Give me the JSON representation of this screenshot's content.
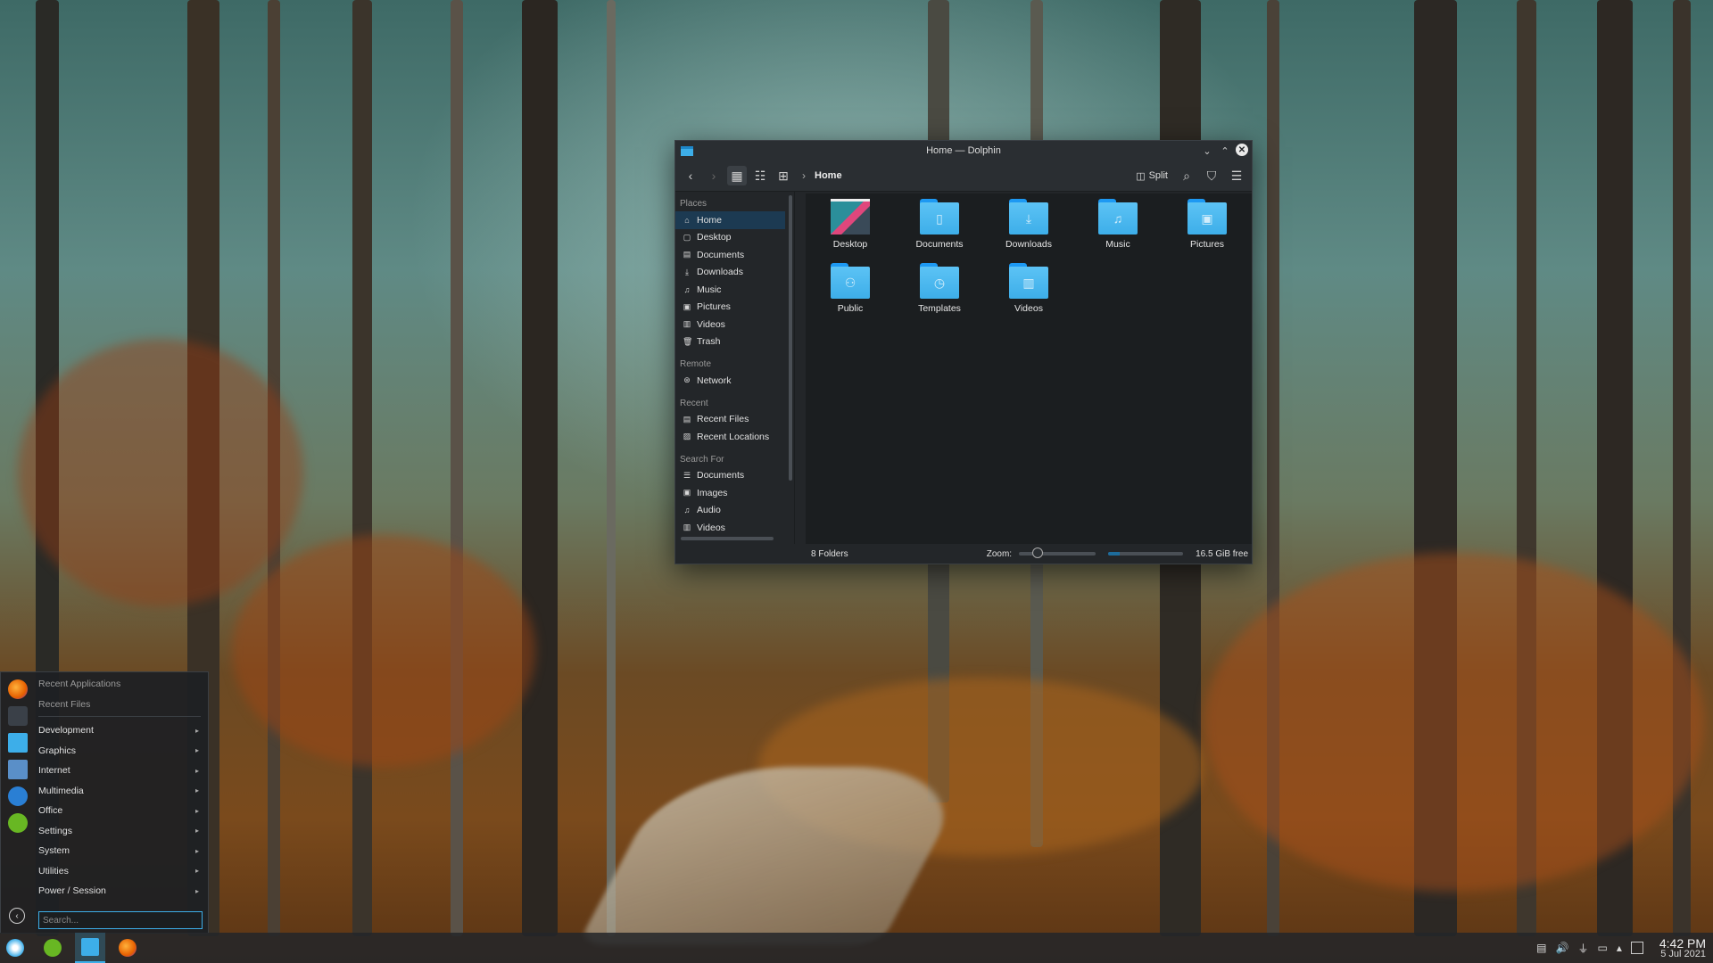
{
  "dolphin": {
    "title": "Home — Dolphin",
    "breadcrumb": "Home",
    "split_label": "Split",
    "places": {
      "places_title": "Places",
      "places_items": [
        "Home",
        "Desktop",
        "Documents",
        "Downloads",
        "Music",
        "Pictures",
        "Videos",
        "Trash"
      ],
      "remote_title": "Remote",
      "remote_items": [
        "Network"
      ],
      "recent_title": "Recent",
      "recent_items": [
        "Recent Files",
        "Recent Locations"
      ],
      "search_title": "Search For",
      "search_items": [
        "Documents",
        "Images",
        "Audio",
        "Videos"
      ]
    },
    "folders": [
      "Desktop",
      "Documents",
      "Downloads",
      "Music",
      "Pictures",
      "Public",
      "Templates",
      "Videos"
    ],
    "status": {
      "count": "8 Folders",
      "zoom_label": "Zoom:",
      "free": "16.5 GiB free",
      "zoom_fraction": 0.2,
      "used_fraction": 0.15
    }
  },
  "menu": {
    "recent_apps": "Recent Applications",
    "recent_files": "Recent Files",
    "categories": [
      "Development",
      "Graphics",
      "Internet",
      "Multimedia",
      "Office",
      "Settings",
      "System",
      "Utilities",
      "Power / Session"
    ],
    "search_placeholder": "Search..."
  },
  "panel": {
    "time": "4:42 PM",
    "date": "5 Jul 2021"
  },
  "colors": {
    "accent": "#3daee9",
    "folder": "#3daee9",
    "window_bg": "#232629"
  }
}
